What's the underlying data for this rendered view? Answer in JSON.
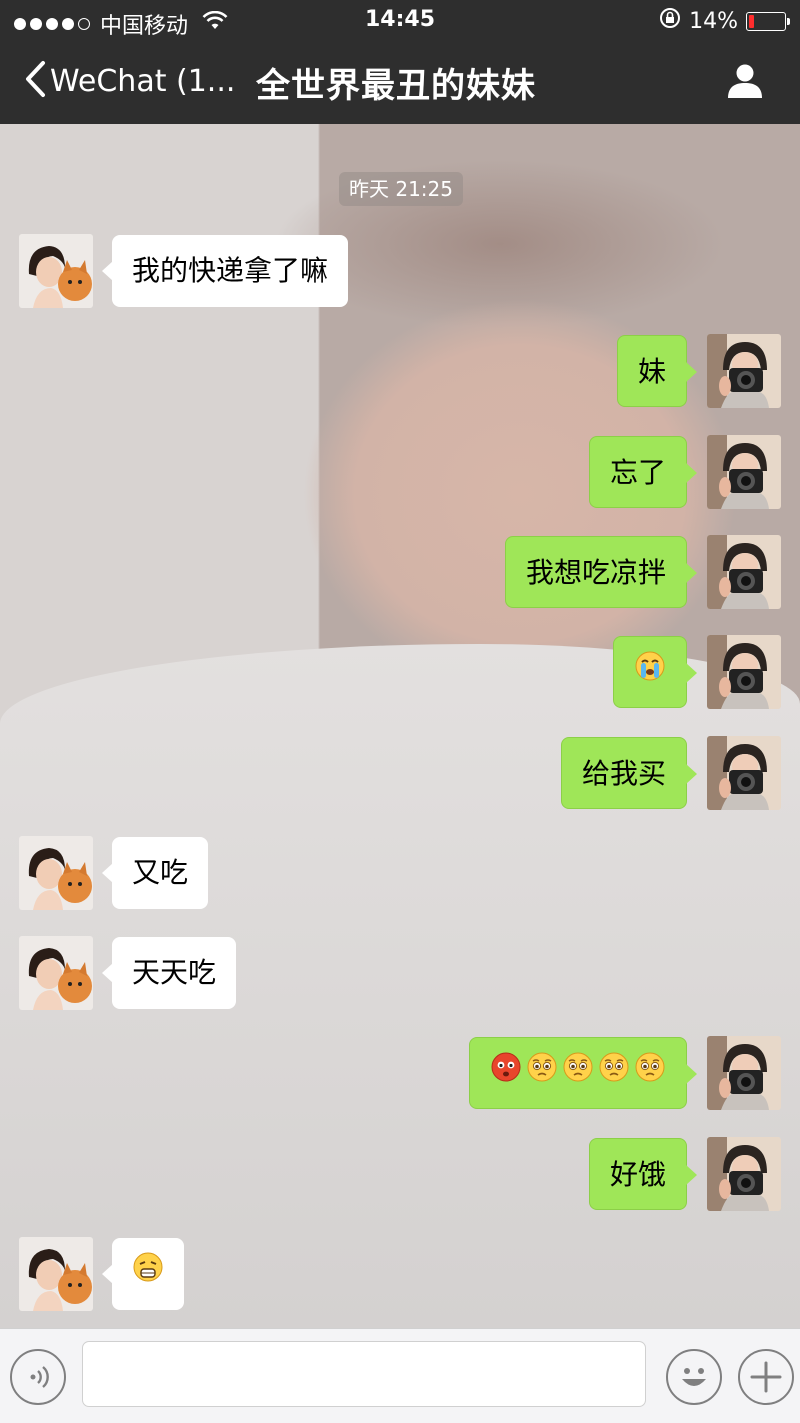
{
  "status_bar": {
    "carrier": "中国移动",
    "time": "14:45",
    "battery": "14%",
    "battery_level": 0.14
  },
  "nav": {
    "back_label": "WeChat (1...",
    "title": "全世界最丑的妹妹"
  },
  "chat": {
    "timestamp": "昨天 21:25",
    "messages": [
      {
        "side": "in",
        "text": "我的快递拿了嘛"
      },
      {
        "side": "out",
        "text": "妹"
      },
      {
        "side": "out",
        "text": "忘了"
      },
      {
        "side": "out",
        "text": "我想吃凉拌"
      },
      {
        "side": "out",
        "emoji": [
          "crying-emoji"
        ]
      },
      {
        "side": "out",
        "text": "给我买"
      },
      {
        "side": "in",
        "text": "又吃"
      },
      {
        "side": "in",
        "text": "天天吃"
      },
      {
        "side": "out",
        "emoji": [
          "angry-red-emoji",
          "sad-emoji",
          "sad-emoji",
          "sad-emoji",
          "sad-emoji"
        ]
      },
      {
        "side": "out",
        "text": "好饿"
      },
      {
        "side": "in",
        "emoji": [
          "triumph-emoji"
        ]
      }
    ]
  },
  "input_bar": {
    "voice_icon": "voice-icon",
    "emoji_icon": "smiley-icon",
    "plus_icon": "plus-icon",
    "value": ""
  },
  "colors": {
    "bar_bg": "#2e2e2e",
    "bubble_out": "#9fe658",
    "bubble_in": "#ffffff",
    "battery_low": "#ff2d2d"
  }
}
